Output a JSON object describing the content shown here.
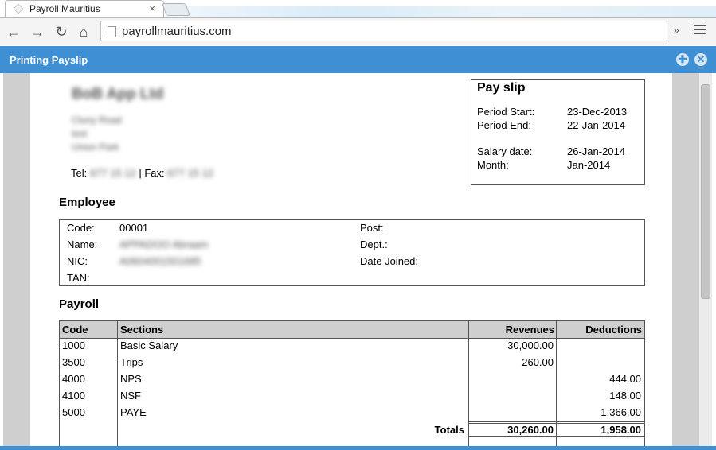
{
  "browser": {
    "tab_title": "Payroll Mauritius",
    "tab_close": "×",
    "url": "payrollmauritius.com",
    "ext_button": "»"
  },
  "dialog": {
    "title": "Printing Payslip"
  },
  "company": {
    "name": "BoB App Ltd",
    "address": [
      "Cluny Road",
      "test",
      "Union Park"
    ],
    "tel_label": "Tel:",
    "tel_value": "677 15 12",
    "fax_label": "| Fax:",
    "fax_value": "677 15 12"
  },
  "payslip": {
    "title": "Pay slip",
    "period_start_label": "Period Start:",
    "period_start": "23-Dec-2013",
    "period_end_label": "Period End:",
    "period_end": "22-Jan-2014",
    "salary_date_label": "Salary date:",
    "salary_date": "26-Jan-2014",
    "month_label": "Month:",
    "month": "Jan-2014"
  },
  "employee": {
    "heading": "Employee",
    "code_label": "Code:",
    "code": "00001",
    "name_label": "Name:",
    "name": "APPADOO Abraam",
    "nic_label": "NIC:",
    "nic": "A0604001501685",
    "tan_label": "TAN:",
    "post_label": "Post:",
    "dept_label": "Dept.:",
    "joined_label": "Date Joined:"
  },
  "payroll": {
    "heading": "Payroll",
    "columns": {
      "code": "Code",
      "sections": "Sections",
      "revenues": "Revenues",
      "deductions": "Deductions"
    },
    "rows": [
      {
        "code": "1000",
        "section": "Basic Salary",
        "revenue": "30,000.00",
        "deduction": ""
      },
      {
        "code": "3500",
        "section": "Trips",
        "revenue": "260.00",
        "deduction": ""
      },
      {
        "code": "4000",
        "section": "NPS",
        "revenue": "",
        "deduction": "444.00"
      },
      {
        "code": "4100",
        "section": "NSF",
        "revenue": "",
        "deduction": "148.00"
      },
      {
        "code": "5000",
        "section": "PAYE",
        "revenue": "",
        "deduction": "1,366.00"
      }
    ],
    "totals_label": "Totals",
    "total_revenue": "30,260.00",
    "total_deduction": "1,958.00"
  }
}
